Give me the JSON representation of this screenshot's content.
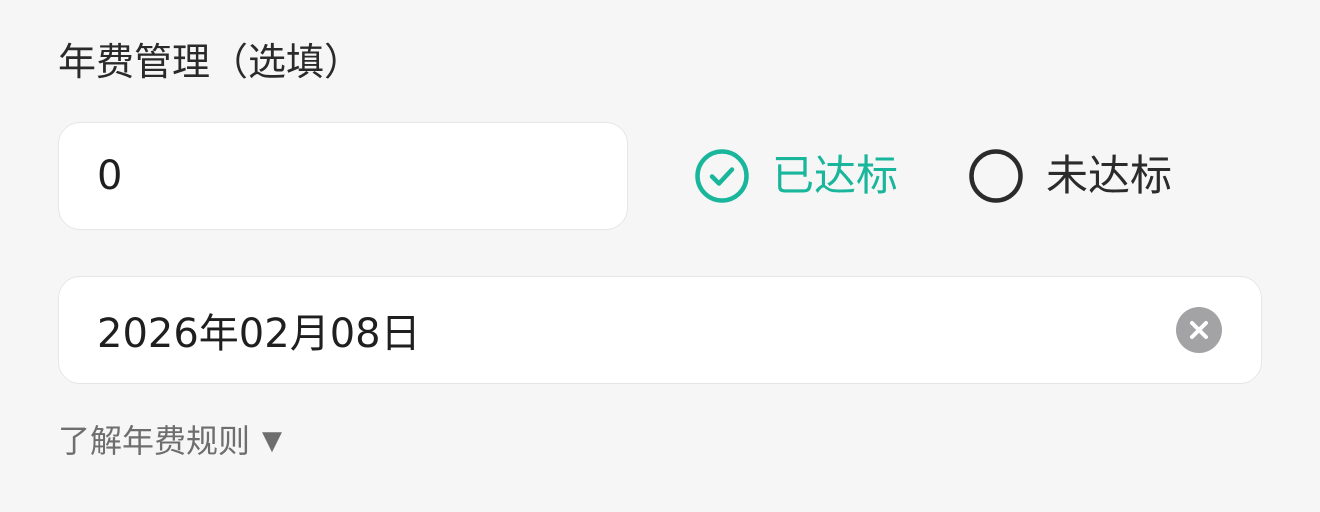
{
  "section": {
    "title": "年费管理（选填）"
  },
  "amount": {
    "value": "0"
  },
  "status_options": [
    {
      "label": "已达标",
      "selected": true,
      "color": "#1ab69b"
    },
    {
      "label": "未达标",
      "selected": false,
      "color": "#2b2b2b"
    }
  ],
  "date": {
    "value": "2026年02月08日"
  },
  "rules_link": {
    "label": "了解年费规则",
    "arrow": "▼"
  },
  "icons": {
    "selected_radio": "check-circle-icon",
    "unselected_radio": "empty-circle-icon",
    "clear": "clear-icon"
  }
}
